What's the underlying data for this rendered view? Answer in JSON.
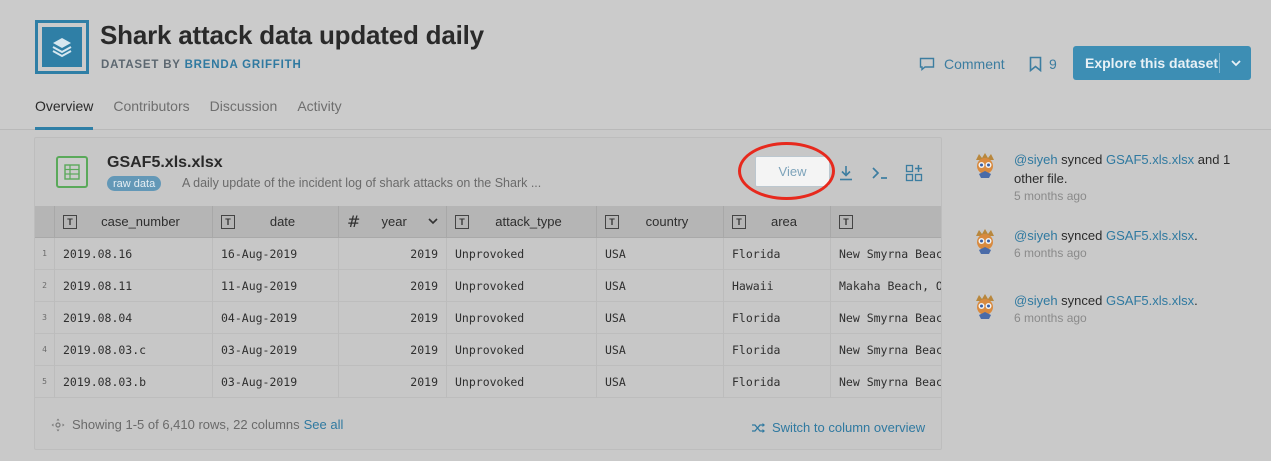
{
  "dataset": {
    "title": "Shark attack data updated daily",
    "byline_prefix": "DATASET BY",
    "author": "BRENDA GRIFFITH"
  },
  "actions": {
    "comment_label": "Comment",
    "bookmark_count": "9",
    "explore_label": "Explore this dataset"
  },
  "tabs": [
    {
      "label": "Overview",
      "active": true
    },
    {
      "label": "Contributors",
      "active": false
    },
    {
      "label": "Discussion",
      "active": false
    },
    {
      "label": "Activity",
      "active": false
    }
  ],
  "file": {
    "name": "GSAF5.xls.xlsx",
    "badge": "raw data",
    "description": "A daily update of the incident log of shark attacks on the Shark ...",
    "view_label": "View"
  },
  "table": {
    "columns": [
      {
        "type": "text",
        "label": "case_number"
      },
      {
        "type": "text",
        "label": "date"
      },
      {
        "type": "number",
        "label": "year"
      },
      {
        "type": "text",
        "label": "attack_type"
      },
      {
        "type": "text",
        "label": "country"
      },
      {
        "type": "text",
        "label": "area"
      },
      {
        "type": "text",
        "label": ""
      }
    ],
    "rows": [
      [
        "1",
        "2019.08.16",
        "16-Aug-2019",
        "2019",
        "Unprovoked",
        "USA",
        "Florida",
        "New Smyrna Beach"
      ],
      [
        "2",
        "2019.08.11",
        "11-Aug-2019",
        "2019",
        "Unprovoked",
        "USA",
        "Hawaii",
        "Makaha Beach, Oa"
      ],
      [
        "3",
        "2019.08.04",
        "04-Aug-2019",
        "2019",
        "Unprovoked",
        "USA",
        "Florida",
        "New Smyrna Beach"
      ],
      [
        "4",
        "2019.08.03.c",
        "03-Aug-2019",
        "2019",
        "Unprovoked",
        "USA",
        "Florida",
        "New Smyrna Beach"
      ],
      [
        "5",
        "2019.08.03.b",
        "03-Aug-2019",
        "2019",
        "Unprovoked",
        "USA",
        "Florida",
        "New Smyrna Beach"
      ]
    ]
  },
  "footer": {
    "showing": "Showing 1-5 of 6,410 rows, 22 columns",
    "see_all": "See all",
    "switch": "Switch to column overview"
  },
  "feed": [
    {
      "user": "@siyeh",
      "verb": "synced",
      "file": "GSAF5.xls.xlsx",
      "suffix": "and 1 other file.",
      "time": "5 months ago"
    },
    {
      "user": "@siyeh",
      "verb": "synced",
      "file": "GSAF5.xls.xlsx",
      "suffix": ".",
      "time": "6 months ago"
    },
    {
      "user": "@siyeh",
      "verb": "synced",
      "file": "GSAF5.xls.xlsx",
      "suffix": ".",
      "time": "6 months ago"
    }
  ],
  "colors": {
    "accent": "#2f7fa6",
    "highlight_ring": "#e7291d",
    "file_icon": "#5aa95a"
  }
}
